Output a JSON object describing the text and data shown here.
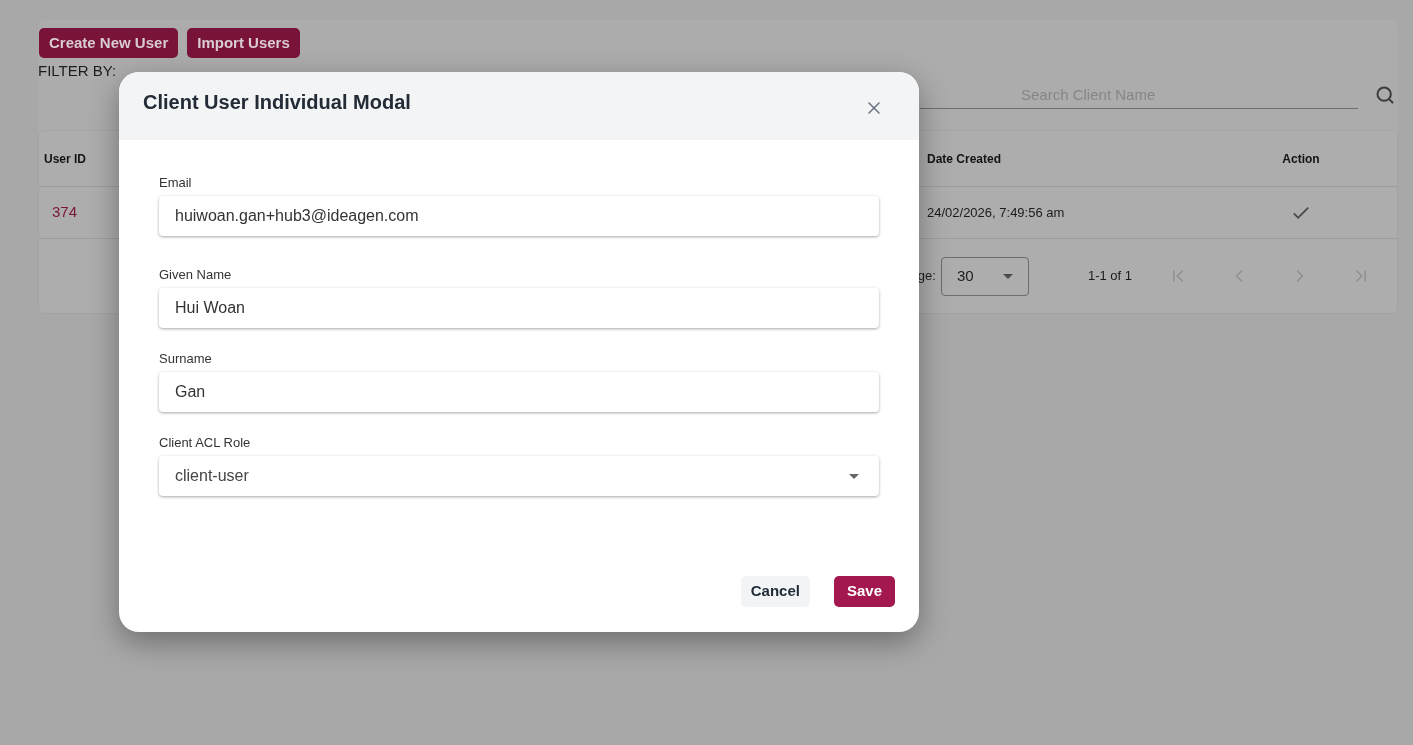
{
  "toolbar": {
    "buttons": [
      "Create New User",
      "Import Users"
    ]
  },
  "filter": {
    "label": "FILTER BY:",
    "search": {
      "placeholder": "Search Client Name"
    }
  },
  "table": {
    "columns": [
      "User ID",
      "Date Created",
      "Action"
    ],
    "rows": [
      {
        "user_id": "374",
        "date_created": "24/02/2026, 7:49:56 am"
      }
    ]
  },
  "pagination": {
    "rows_per_page_label": "ge:",
    "rows_per_page": "30",
    "range": "1-1 of 1",
    "buttons": [
      {
        "kind": "first",
        "disabled": true
      },
      {
        "kind": "previous",
        "disabled": true
      },
      {
        "kind": "next",
        "disabled": true
      },
      {
        "kind": "last",
        "disabled": true
      }
    ]
  },
  "modal": {
    "title": "Client User Individual Modal",
    "fields": [
      {
        "kind": "text",
        "label": "Email",
        "value": "huiwoan.gan+hub3@ideagen.com"
      },
      {
        "kind": "text",
        "label": "Given Name",
        "value": "Hui Woan"
      },
      {
        "kind": "text",
        "label": "Surname",
        "value": "Gan"
      },
      {
        "kind": "select",
        "label": "Client ACL Role",
        "value": "client-user"
      }
    ],
    "buttons": [
      {
        "kind": "secondary",
        "label": "Cancel"
      },
      {
        "kind": "primary",
        "label": "Save"
      }
    ]
  }
}
